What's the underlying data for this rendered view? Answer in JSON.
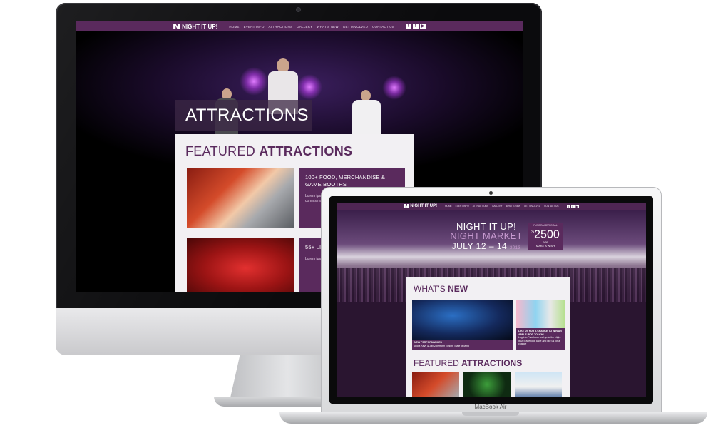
{
  "site": {
    "brand": "NIGHT IT UP!",
    "nav": [
      "HOME",
      "EVENT INFO",
      "ATTRACTIONS",
      "GALLERY",
      "WHAT'S NEW",
      "GET INVOLVED",
      "CONTACT US"
    ],
    "social": [
      "t",
      "f",
      "▶"
    ]
  },
  "desktop": {
    "page_heading": "ATTRACTIONS",
    "featured_light": "FEATURED ",
    "featured_bold": "ATTRACTIONS",
    "items": [
      {
        "heading": "100+ FOOD, MERCHANDISE & GAME BOOTHS",
        "text": "Lorem ipsum dolor sit amet consectetur fugiandi nisi que comnis maiorumquam sam ad ex"
      },
      {
        "heading": "55+ LI",
        "text": "Lorem ipsum dolor sit fugiandi que comnis sam ad ex"
      }
    ]
  },
  "laptop": {
    "hero_line1": "NIGHT IT UP!",
    "hero_line2": "NIGHT MARKET",
    "hero_dates": "JULY 12 – 14",
    "hero_year": "2013",
    "goal_caption": "FUNDRAISER GOAL",
    "goal_amount": "2500",
    "goal_currency": "$",
    "goal_for": "FOR",
    "goal_target": "MAKE A WISH",
    "whats_new_light": "WHAT'S ",
    "whats_new_bold": "NEW",
    "news_caption_title": "NEW PERFORMANCES",
    "news_caption_text": "Alicia Keys & Jay-Z perform Empire State of Mind",
    "ad_title": "LIKE US FOR A CHANCE TO WIN AN APPLE IPOD TOUCH!",
    "ad_text": "Log into Facebook and go to the Night It Up Facebook page and like us for a chance",
    "featured_light": "FEATURED ",
    "featured_bold": "ATTRACTIONS",
    "device_label": "MacBook Air"
  }
}
